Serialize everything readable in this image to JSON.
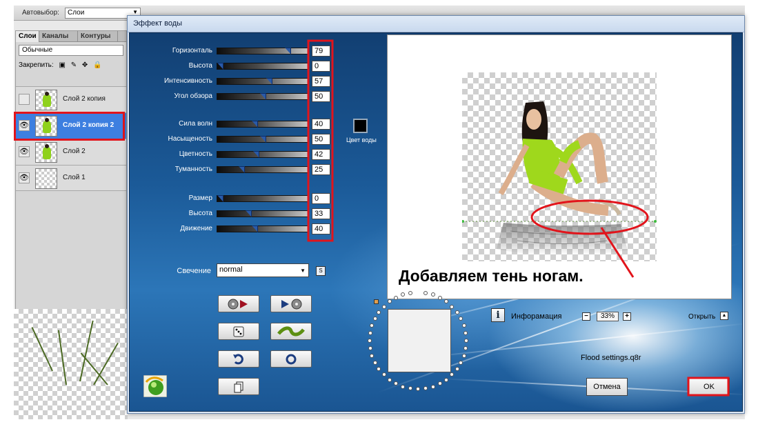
{
  "photoshop": {
    "autoselect_label": "Автовыбор:",
    "autoselect_value": "Слои",
    "panel_tabs": [
      "Слои",
      "Каналы",
      "Контуры"
    ],
    "blend_mode": "Обычные",
    "lock_label": "Закрепить:",
    "layers": [
      {
        "name": "Слой 2 копия",
        "visible": false,
        "selected": false
      },
      {
        "name": "Слой 2 копия 2",
        "visible": true,
        "selected": true
      },
      {
        "name": "Слой 2",
        "visible": true,
        "selected": false
      },
      {
        "name": "Слой 1",
        "visible": true,
        "selected": false
      }
    ]
  },
  "plugin": {
    "title": "Эффект воды",
    "group1": [
      {
        "label": "Горизонталь",
        "value": "79",
        "level": 0.79
      },
      {
        "label": "Высота",
        "value": "0",
        "level": 0.0
      },
      {
        "label": "Интенсивность",
        "value": "57",
        "level": 0.57
      },
      {
        "label": "Угол обзора",
        "value": "50",
        "level": 0.5
      }
    ],
    "group2": [
      {
        "label": "Сила волн",
        "value": "40",
        "level": 0.4
      },
      {
        "label": "Насыщеность",
        "value": "50",
        "level": 0.5
      },
      {
        "label": "Цветность",
        "value": "42",
        "level": 0.42
      },
      {
        "label": "Туманность",
        "value": "25",
        "level": 0.25
      }
    ],
    "group3": [
      {
        "label": "Размер",
        "value": "0",
        "level": 0.0
      },
      {
        "label": "Высота",
        "value": "33",
        "level": 0.33
      },
      {
        "label": "Движение",
        "value": "40",
        "level": 0.4
      }
    ],
    "water_color_label": "Цвет воды",
    "water_color": "#000000",
    "glow_label": "Свечение",
    "glow_value": "normal",
    "glow_button": "S",
    "info_label": "Инфорамация",
    "zoom": "33%",
    "open_label": "Открыть",
    "settings_file": "Flood settings.q8r",
    "cancel_label": "Отмена",
    "ok_label": "OK",
    "caption": "Добавляем тень ногам.",
    "highlight_color": "#e2141b",
    "tool_icons": [
      "play-forward-icon",
      "play-back-icon",
      "dice-icon",
      "wave-icon",
      "undo-icon",
      "reset-icon",
      "copy-icon"
    ]
  }
}
